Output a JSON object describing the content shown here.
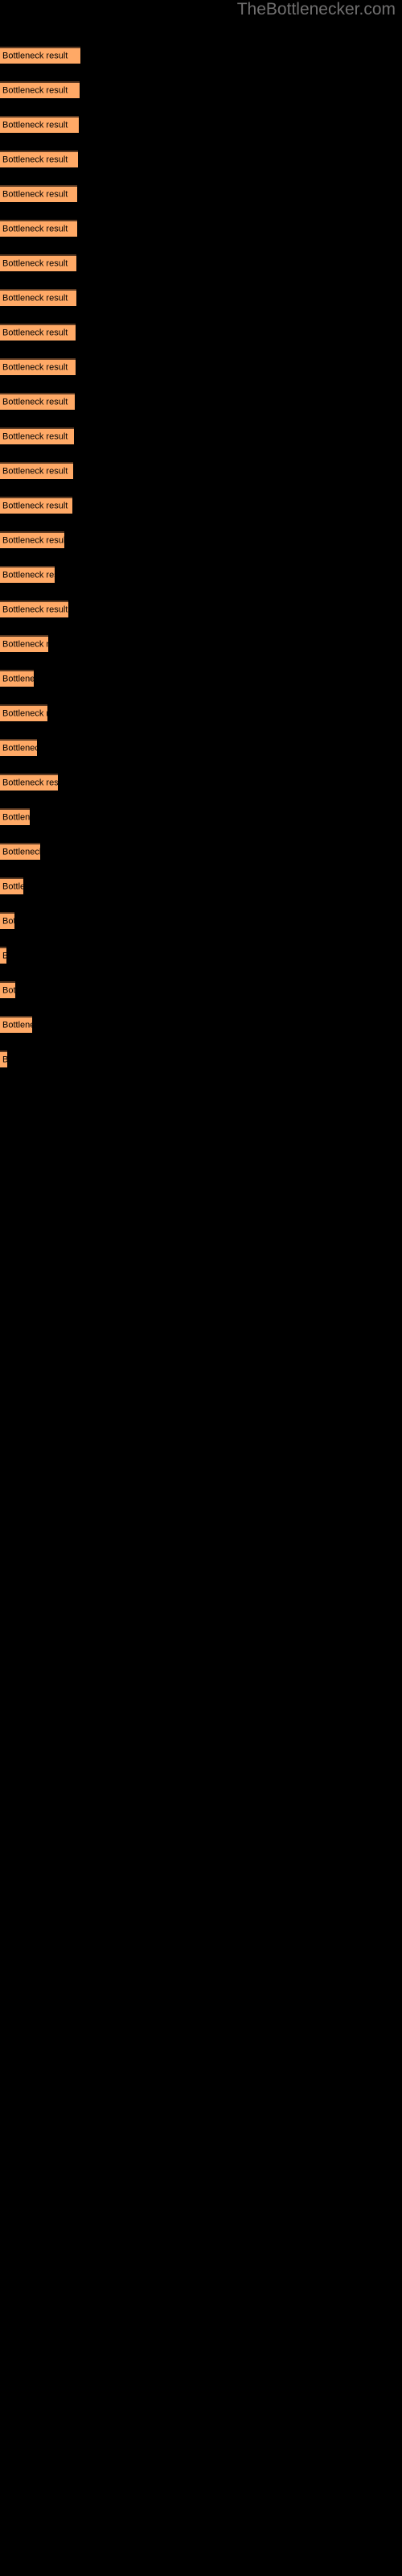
{
  "header": {
    "site_title": "TheBottlenecker.com"
  },
  "colors": {
    "background": "#000000",
    "bar_fill": "#ffa966",
    "bar_border_top": "#5c3a22",
    "bar_label": "#000000",
    "title": "#706f6f"
  },
  "chart_data": {
    "type": "bar",
    "orientation": "horizontal",
    "title": "TheBottlenecker.com",
    "xlabel": "",
    "ylabel": "",
    "grid": false,
    "legend": false,
    "bar_label_text": "Bottleneck result",
    "categories": [
      "Bottleneck result",
      "Bottleneck result",
      "Bottleneck result",
      "Bottleneck result",
      "Bottleneck result",
      "Bottleneck result",
      "Bottleneck result",
      "Bottleneck result",
      "Bottleneck result",
      "Bottleneck result",
      "Bottleneck result",
      "Bottleneck result",
      "Bottleneck result",
      "Bottleneck result",
      "Bottleneck result",
      "Bottleneck result",
      "Bottleneck result",
      "Bottleneck result",
      "Bottleneck result",
      "Bottleneck result",
      "Bottleneck result",
      "Bottleneck result",
      "Bottleneck result",
      "Bottleneck result",
      "Bottleneck result",
      "Bottleneck result",
      "Bottleneck result",
      "Bottleneck result",
      "Bottleneck result",
      "Bottleneck result"
    ],
    "values": [
      100,
      99,
      98,
      97,
      96,
      95,
      94,
      93,
      92,
      91,
      90,
      89,
      88,
      87,
      86,
      77,
      65,
      81,
      57,
      40,
      56,
      44,
      69,
      35,
      48,
      28,
      17,
      8,
      18,
      38
    ],
    "value_unit": "px-width",
    "xlim": [
      0,
      500
    ],
    "bars": [
      {
        "label": "Bottleneck result",
        "width": 100,
        "top": 58
      },
      {
        "label": "Bottleneck result",
        "width": 99,
        "top": 101
      },
      {
        "label": "Bottleneck result",
        "width": 98,
        "top": 144
      },
      {
        "label": "Bottleneck result",
        "width": 97,
        "top": 187
      },
      {
        "label": "Bottleneck result",
        "width": 96,
        "top": 230
      },
      {
        "label": "Bottleneck result",
        "width": 96,
        "top": 273
      },
      {
        "label": "Bottleneck result",
        "width": 95,
        "top": 316
      },
      {
        "label": "Bottleneck result",
        "width": 95,
        "top": 359
      },
      {
        "label": "Bottleneck result",
        "width": 94,
        "top": 402
      },
      {
        "label": "Bottleneck result",
        "width": 94,
        "top": 445
      },
      {
        "label": "Bottleneck result",
        "width": 93,
        "top": 488
      },
      {
        "label": "Bottleneck result",
        "width": 92,
        "top": 531
      },
      {
        "label": "Bottleneck result",
        "width": 91,
        "top": 574
      },
      {
        "label": "Bottleneck result",
        "width": 90,
        "top": 617
      },
      {
        "label": "Bottleneck result",
        "width": 80,
        "top": 660
      },
      {
        "label": "Bottleneck result",
        "width": 68,
        "top": 703
      },
      {
        "label": "Bottleneck result",
        "width": 85,
        "top": 746
      },
      {
        "label": "Bottleneck result",
        "width": 60,
        "top": 789
      },
      {
        "label": "Bottleneck result",
        "width": 42,
        "top": 832
      },
      {
        "label": "Bottleneck result",
        "width": 59,
        "top": 875
      },
      {
        "label": "Bottleneck result",
        "width": 46,
        "top": 918
      },
      {
        "label": "Bottleneck result",
        "width": 72,
        "top": 961
      },
      {
        "label": "Bottleneck result",
        "width": 37,
        "top": 1004
      },
      {
        "label": "Bottleneck result",
        "width": 50,
        "top": 1047
      },
      {
        "label": "Bottleneck result",
        "width": 29,
        "top": 1090
      },
      {
        "label": "Bottleneck result",
        "width": 18,
        "top": 1133
      },
      {
        "label": "Bottleneck result",
        "width": 8,
        "top": 1176
      },
      {
        "label": "Bottleneck result",
        "width": 19,
        "top": 1219
      },
      {
        "label": "Bottleneck result",
        "width": 40,
        "top": 1262
      },
      {
        "label": "Bottleneck result",
        "width": 9,
        "top": 1305
      }
    ]
  }
}
